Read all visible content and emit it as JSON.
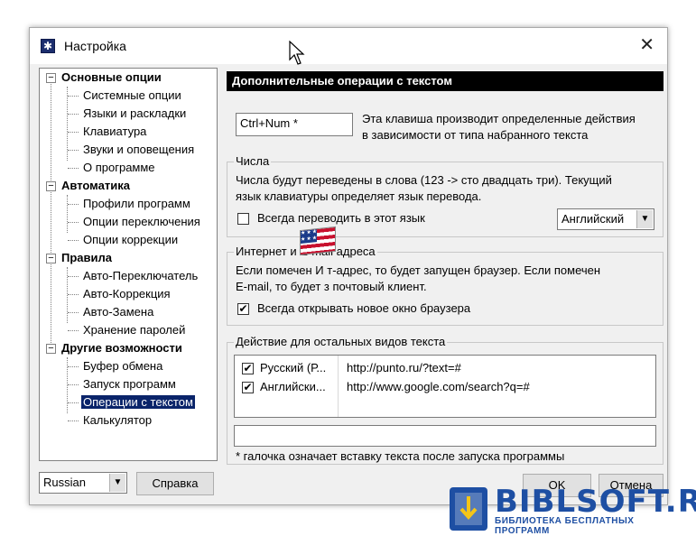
{
  "window": {
    "title": "Настройка",
    "close_glyph": "✕",
    "icon": "settings-app-icon"
  },
  "tree": {
    "groups": [
      {
        "label": "Основные опции",
        "items": [
          "Системные опции",
          "Языки и раскладки",
          "Клавиатура",
          "Звуки и оповещения",
          "О программе"
        ]
      },
      {
        "label": "Автоматика",
        "items": [
          "Профили программ",
          "Опции переключения",
          "Опции коррекции"
        ]
      },
      {
        "label": "Правила",
        "items": [
          "Авто-Переключатель",
          "Авто-Коррекция",
          "Авто-Замена",
          "Хранение паролей"
        ]
      },
      {
        "label": "Другие возможности",
        "items": [
          "Буфер обмена",
          "Запуск программ",
          "Операции с текстом",
          "Калькулятор"
        ]
      }
    ],
    "selected": "Операции с текстом",
    "expander_glyph": "−"
  },
  "footer": {
    "language_value": "Russian",
    "help_label": "Справка",
    "ok_label": "OK",
    "cancel_label": "Отмена"
  },
  "panel": {
    "header": "Дополнительные операции с текстом",
    "hotkey_value": "Ctrl+Num *",
    "hotkey_desc": [
      "Эта клавиша производит определенные действия",
      "в зависимости от типа набранного текста"
    ],
    "numbers": {
      "title": "Числа",
      "desc": [
        "Числа будут переведены в слова (123 -> сто двадцать три). Текущий",
        "язык клавиатуры определяет язык перевода."
      ],
      "checkbox_label": "Всегда переводить в этот язык",
      "checked": false,
      "language_select": "Английский"
    },
    "internet": {
      "title": "Интернет и E-mail адреса",
      "desc": [
        "Если помечен И          т-адрес, то будет запущен браузер. Если помечен",
        "E-mail, то будет з          почтовый клиент."
      ],
      "checkbox_label": "Всегда открывать новое окно браузера",
      "checked": true
    },
    "actions": {
      "title": "Действие для остальных видов текста",
      "rows": [
        {
          "checked": true,
          "name": "Русский (Р...",
          "url": "http://punto.ru/?text=#"
        },
        {
          "checked": true,
          "name": "Английски...",
          "url": "http://www.google.com/search?q=#"
        }
      ],
      "edit_value": "",
      "note": "* галочка означает вставку текста после запуска программы"
    }
  },
  "watermark": {
    "title": "BIBLSOFT.RU",
    "subtitle": "БИБЛИОТЕКА БЕСПЛАТНЫХ ПРОГРАММ"
  },
  "colors": {
    "header_bg": "#000000",
    "selection_bg": "#0a246a",
    "window_bg": "#f0f0f0",
    "watermark": "#1e4fa3"
  }
}
